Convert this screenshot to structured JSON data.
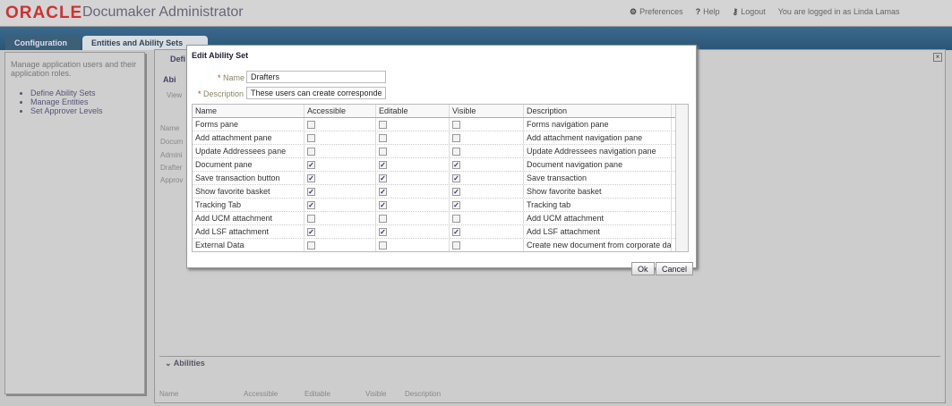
{
  "header": {
    "logo": "ORACLE",
    "title": "Documaker Administrator",
    "preferences": "Preferences",
    "help": "Help",
    "logout": "Logout",
    "user": "You are logged in as Linda Lamas"
  },
  "tabs": [
    {
      "label": "Configuration"
    },
    {
      "label": "Entities and Ability Sets"
    }
  ],
  "sidebar": {
    "intro": "Manage application users and their application roles.",
    "links": [
      "Define Ability Sets",
      "Manage Entities",
      "Set Approver Levels"
    ]
  },
  "background": {
    "section_title": "Defi",
    "panel": "Abi",
    "view": "View",
    "list": [
      "Name",
      "Docum",
      "Admini",
      "Drafter",
      "Approv"
    ],
    "abilities_title": "Abilities",
    "abilities_columns": [
      "Name",
      "Accessible",
      "Editable",
      "Visible",
      "Description"
    ]
  },
  "dialog": {
    "title": "Edit Ability Set",
    "name_label": "Name",
    "name_value": "Drafters",
    "description_label": "Description",
    "description_value": "These users can create correspondence",
    "columns": [
      "Name",
      "Accessible",
      "Editable",
      "Visible",
      "Description"
    ],
    "rows": [
      {
        "name": "Forms pane",
        "accessible": false,
        "editable": false,
        "visible": false,
        "description": "Forms navigation pane"
      },
      {
        "name": "Add attachment pane",
        "accessible": false,
        "editable": false,
        "visible": false,
        "description": "Add attachment navigation pane"
      },
      {
        "name": "Update Addressees pane",
        "accessible": false,
        "editable": false,
        "visible": false,
        "description": "Update Addressees navigation pane"
      },
      {
        "name": "Document pane",
        "accessible": true,
        "editable": true,
        "visible": true,
        "description": "Document navigation pane"
      },
      {
        "name": "Save transaction button",
        "accessible": true,
        "editable": true,
        "visible": true,
        "description": "Save transaction"
      },
      {
        "name": "Show favorite basket",
        "accessible": true,
        "editable": true,
        "visible": true,
        "description": "Show favorite basket"
      },
      {
        "name": "Tracking Tab",
        "accessible": true,
        "editable": true,
        "visible": true,
        "description": "Tracking tab"
      },
      {
        "name": "Add UCM attachment",
        "accessible": false,
        "editable": false,
        "visible": false,
        "description": "Add UCM attachment"
      },
      {
        "name": "Add LSF attachment",
        "accessible": true,
        "editable": true,
        "visible": true,
        "description": "Add LSF attachment"
      },
      {
        "name": "External Data",
        "accessible": false,
        "editable": false,
        "visible": false,
        "description": "Create new document from corporate data"
      }
    ],
    "ok": "Ok",
    "cancel": "Cancel"
  }
}
